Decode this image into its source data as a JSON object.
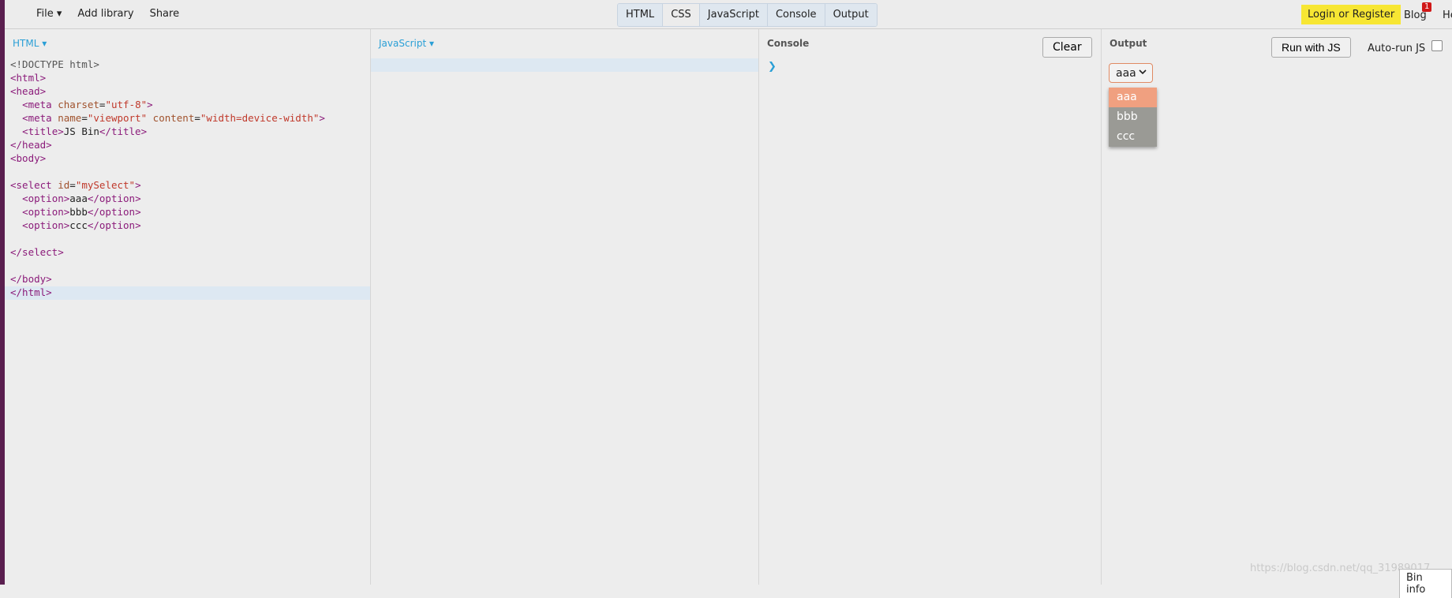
{
  "topbar": {
    "menu": {
      "file": "File ▾",
      "add_library": "Add library",
      "share": "Share"
    },
    "tabs": [
      "HTML",
      "CSS",
      "JavaScript",
      "Console",
      "Output"
    ],
    "login": "Login or Register",
    "blog": "Blog",
    "blog_badge": "1",
    "help": "Help"
  },
  "html_panel": {
    "title": "HTML ▾"
  },
  "js_panel": {
    "title": "JavaScript ▾"
  },
  "console_panel": {
    "title": "Console",
    "clear": "Clear",
    "prompt": "❯"
  },
  "output_panel": {
    "title": "Output",
    "run_button": "Run with JS",
    "autorun_label": "Auto-run JS",
    "select_value": "aaa",
    "options": [
      "aaa",
      "bbb",
      "ccc"
    ]
  },
  "watermark": "https://blog.csdn.net/qq_31989017",
  "bin_info": "Bin info",
  "colors": {
    "accent": "#2a9fd6",
    "login": "#f7e633",
    "badge": "#d01818",
    "selected_option": "#f0a080"
  }
}
